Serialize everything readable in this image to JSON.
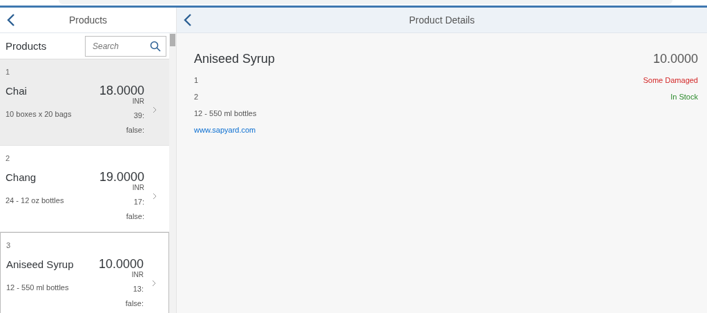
{
  "master": {
    "title": "Products",
    "list_title": "Products",
    "search": {
      "placeholder": "Search"
    },
    "items": [
      {
        "number": "1",
        "name": "Chai",
        "price": "18.0000",
        "currency": "INR",
        "units": "39:",
        "flag": "false:",
        "description": "10 boxes x 20 bags",
        "selected": true,
        "focused": false
      },
      {
        "number": "2",
        "name": "Chang",
        "price": "19.0000",
        "currency": "INR",
        "units": "17:",
        "flag": "false:",
        "description": "24 - 12 oz bottles",
        "selected": false,
        "focused": false
      },
      {
        "number": "3",
        "name": "Aniseed Syrup",
        "price": "10.0000",
        "currency": "INR",
        "units": "13:",
        "flag": "false:",
        "description": "12 - 550 ml bottles",
        "selected": false,
        "focused": true
      }
    ]
  },
  "detail": {
    "title": "Product Details",
    "name": "Aniseed Syrup",
    "price": "10.0000",
    "attributes": [
      {
        "text": "1",
        "status": "Some Damaged",
        "color": "#d32626"
      },
      {
        "text": "2",
        "status": "In Stock",
        "color": "#2b8a2b"
      },
      {
        "text": "12 - 550 ml bottles"
      }
    ],
    "link": "www.sapyard.com"
  }
}
